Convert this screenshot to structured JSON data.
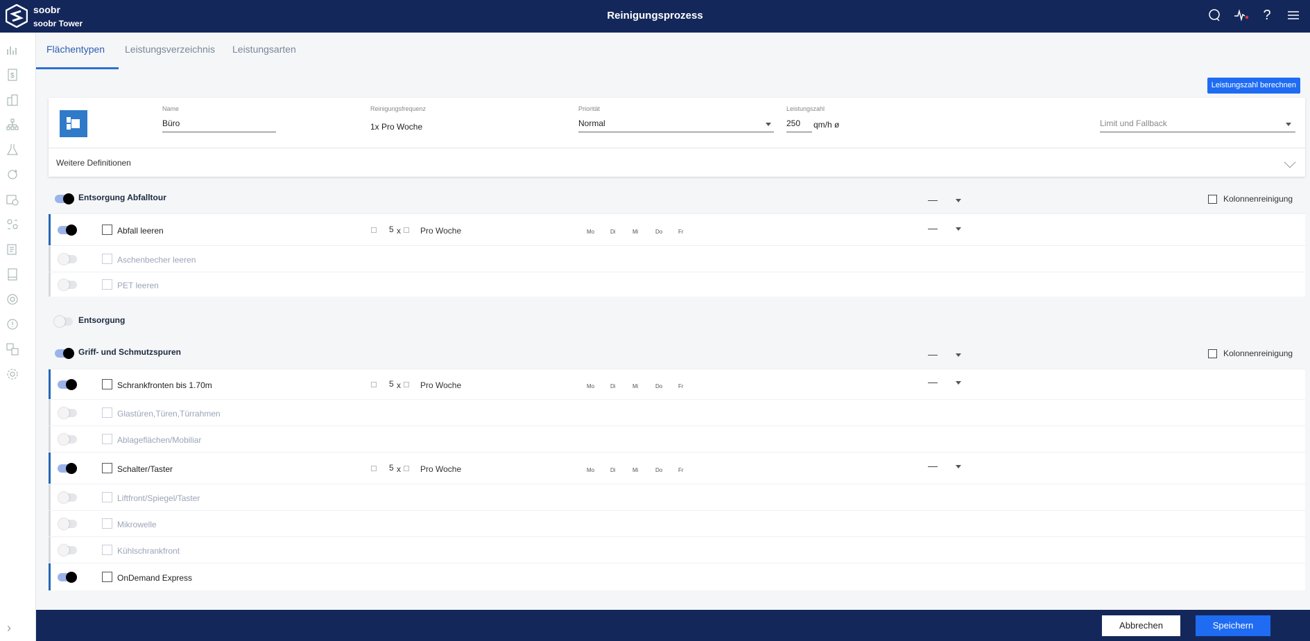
{
  "header": {
    "brand": "soobr",
    "tenant": "soobr Tower",
    "title": "Reinigungsprozess"
  },
  "tabs": [
    {
      "label": "Flächentypen",
      "active": true
    },
    {
      "label": "Leistungsverzeichnis",
      "active": false
    },
    {
      "label": "Leistungsarten",
      "active": false
    }
  ],
  "toolbar": {
    "calc_label": "Leistungszahl berechnen"
  },
  "card": {
    "name_label": "Name",
    "name_value": "Büro",
    "freq_label": "Reinigungsfrequenz",
    "freq_value": "1x Pro Woche",
    "prio_label": "Priorität",
    "prio_value": "Normal",
    "perf_label": "Leistungszahl",
    "perf_value": "250",
    "perf_unit": "qm/h ø",
    "limit_placeholder": "Limit und Fallback",
    "more_label": "Weitere Definitionen"
  },
  "groups": [
    {
      "title": "Entsorgung Abfalltour",
      "enabled": true,
      "col_label": "Kolonnenreinigung",
      "rows": [
        {
          "label": "Abfall leeren",
          "enabled": true,
          "count": "5",
          "count_sep": "x",
          "freq": "Pro Woche",
          "days": [
            "Mo",
            "Di",
            "Mi",
            "Do",
            "Fr"
          ]
        },
        {
          "label": "Aschenbecher leeren",
          "enabled": false
        },
        {
          "label": "PET leeren",
          "enabled": false
        }
      ]
    },
    {
      "title": "Entsorgung",
      "enabled": false
    },
    {
      "title": "Griff- und Schmutzspuren",
      "enabled": true,
      "col_label": "Kolonnenreinigung",
      "rows": [
        {
          "label": "Schrankfronten bis 1.70m",
          "enabled": true,
          "count": "5",
          "count_sep": "x",
          "freq": "Pro Woche",
          "days": [
            "Mo",
            "Di",
            "Mi",
            "Do",
            "Fr"
          ]
        },
        {
          "label": "Glastüren,Türen,Türrahmen",
          "enabled": false
        },
        {
          "label": "Ablageflächen/Mobiliar",
          "enabled": false
        },
        {
          "label": "Schalter/Taster",
          "enabled": true,
          "count": "5",
          "count_sep": "x",
          "freq": "Pro Woche",
          "days": [
            "Mo",
            "Di",
            "Mi",
            "Do",
            "Fr"
          ]
        },
        {
          "label": "Liftfront/Spiegel/Taster",
          "enabled": false
        },
        {
          "label": "Mikrowelle",
          "enabled": false
        },
        {
          "label": "Kühlschrankfront",
          "enabled": false
        },
        {
          "label": "OnDemand Express",
          "enabled": true
        }
      ]
    }
  ],
  "footer": {
    "cancel_label": "Abbrechen",
    "save_label": "Speichern"
  }
}
